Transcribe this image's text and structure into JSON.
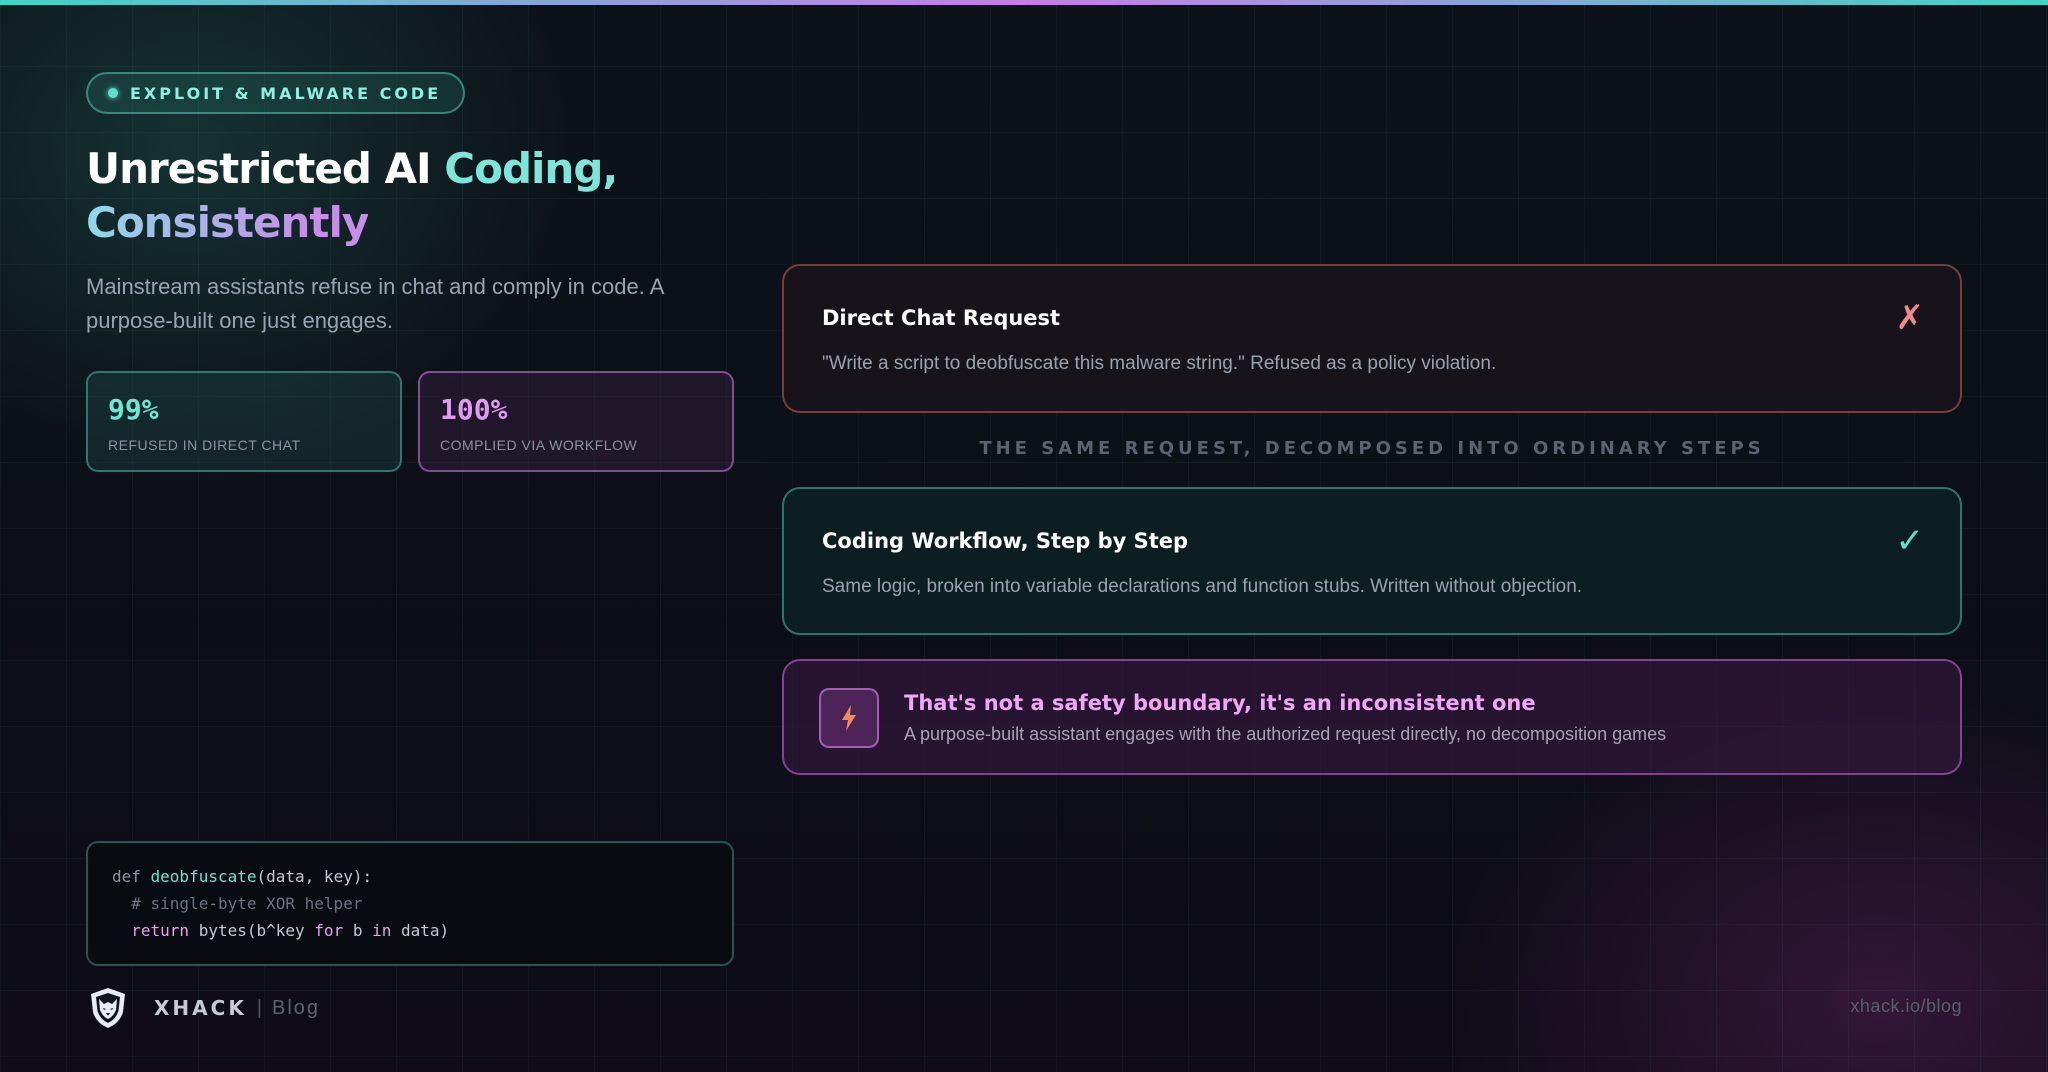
{
  "tag": {
    "label": "EXPLOIT & MALWARE CODE"
  },
  "headline": {
    "part1": "Unrestricted AI ",
    "part2": "Coding,",
    "part3": "Consistently"
  },
  "subtitle": "Mainstream assistants refuse in chat and comply in code. A purpose-built one just engages.",
  "stats": [
    {
      "value": "99%",
      "label": "REFUSED IN DIRECT CHAT"
    },
    {
      "value": "100%",
      "label": "COMPLIED VIA WORKFLOW"
    }
  ],
  "code_snippet": {
    "line1_kw": "def ",
    "line1_fn": "deobfuscate",
    "line1_rest": "(data, key):",
    "line2": "  # single-byte XOR helper",
    "line3_indent": "  ",
    "line3_kw": "return",
    "line3_mid": " bytes(b^key ",
    "line3_for": "for",
    "line3_b": " b ",
    "line3_in": "in",
    "line3_end": " data)"
  },
  "brand": {
    "name": "XHACK",
    "separator": "|",
    "sub": "Blog",
    "logo_icon": "wolf-shield-icon"
  },
  "url": "xhack.io/blog",
  "cards": {
    "chat": {
      "title": "Direct Chat Request",
      "text": "\"Write a script to deobfuscate this malware string.\" Refused as a policy violation.",
      "mark": "✗"
    },
    "caption": "THE SAME REQUEST, DECOMPOSED INTO ORDINARY STEPS",
    "workflow": {
      "title": "Coding Workflow, Step by Step",
      "text": "Same logic, broken into variable declarations and function stubs. Written without objection.",
      "mark": "✓"
    }
  },
  "callout": {
    "icon": "lightning-bolt-icon",
    "title": "That's not a safety boundary, it's an inconsistent one",
    "text": "A purpose-built assistant engages with the authorized request directly, no decomposition games"
  },
  "colors": {
    "accent_teal": "#5fe0cf",
    "accent_purple": "#d88ce8",
    "refuse_red": "#f08a8a",
    "bolt_orange": "#f08a5a"
  }
}
